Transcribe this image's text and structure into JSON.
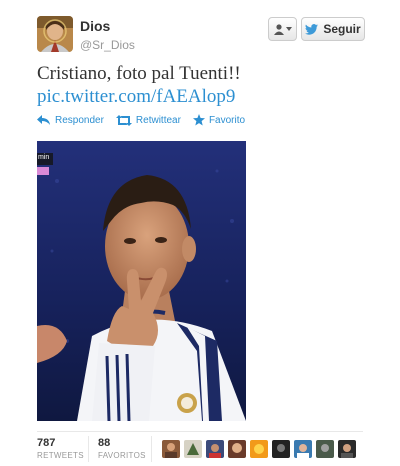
{
  "tweet": {
    "author_name": "Dios",
    "author_handle": "@Sr_Dios",
    "text": "Cristiano, foto pal Tuenti!!",
    "link": "pic.twitter.com/fAEAlop9"
  },
  "header": {
    "follow_label": "Seguir"
  },
  "actions": {
    "reply_label": "Responder",
    "retweet_label": "Retwittear",
    "favorite_label": "Favorito"
  },
  "photo": {
    "overlay_text": "min"
  },
  "stats": {
    "retweets_count": "787",
    "retweets_label": "RETWEETS",
    "favorites_count": "88",
    "favorites_label": "FAVORITOS"
  },
  "colors": {
    "link": "#2c8fd1",
    "twitter_bird": "#3d9ad8",
    "photo_background": "#1c2a66"
  },
  "icons": {
    "reply": "reply-arrow-icon",
    "retweet": "retweet-icon",
    "favorite": "star-icon",
    "user": "user-icon",
    "follow": "twitter-bird-icon"
  }
}
